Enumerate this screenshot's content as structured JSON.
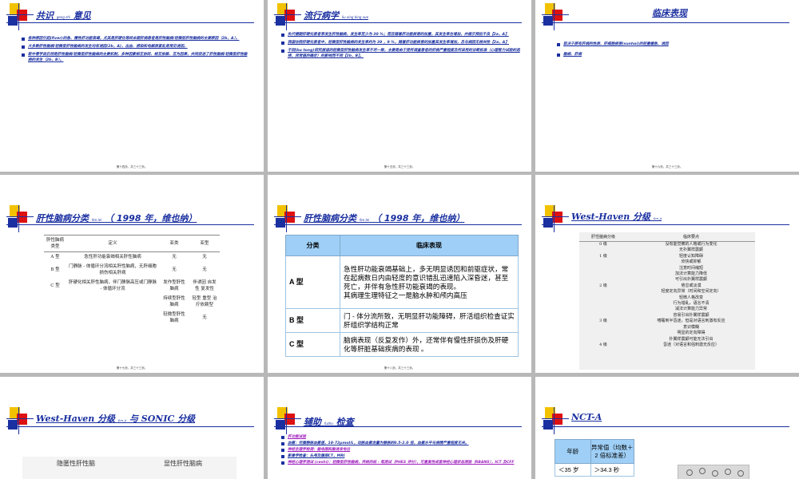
{
  "slides": {
    "s0": {
      "title": "共识",
      "title_small": "gong shi",
      "title_tail": "意见",
      "bullets": [
        "各种原因引起(fiver)的急、慢性肝功能衰竭，尤其是肝硬化等终末期肝病患者是肝性脑病/轻微型肝性脑病的主要原因（2b，A）。",
        "大多数肝性脑病/轻微型肝性脑病的发生均有诱因(2b，A)，出血、感染和电解质紊乱是常见诱因。",
        "新中青学说仍然是肝性脑病/轻微型肝性脑病的主要机制，多种因素相互协同、相互依赖、互为因果，共同促进了肝性脑病/轻微型肝性脑病的发生（2b，B）。"
      ],
      "footer": "第十四页，共三十三页。"
    },
    "s1": {
      "title": "流行病学",
      "title_small": "liu xing bing xue",
      "bullets": [
        "失代偿期肝硬化患者常发生肝性脑病，发生率至少为 30 %；而且随着肝功能损害的加重，其发生率也增加，并提示预后不良【2a，A】",
        "我国住院肝硬化患者中，轻微型肝性脑病的发生率约为 39 ，9 %，随着肝功能损害的加重其发生率增加，且与病因无相关性【2a，A】",
        "不同(bu tong)研究报道的轻微型肝性脑病发生率不尽一致，主要是由于受所调查患者的肝病严重程度及所采用的诊断标准（心理智力试验的选择，异常值的确定）的影响而不同【2b，B】。"
      ],
      "footer": "第十五页，共三十三页。"
    },
    "s2": {
      "title": "临床表现",
      "bullets": [
        "取决于原有肝病的性质、肝细胞损害(sunhai)的轻重缓急、诱因",
        "脑病、肝病"
      ],
      "footer": "第十六页，共三十三页。"
    },
    "s3": {
      "title": "肝性脑病分类",
      "title_small": "fen lei",
      "title_tail": "（ 1998 年，维也纳）",
      "table": {
        "headers": [
          "肝性脑病类型",
          "定义",
          "亚类",
          "亚型"
        ],
        "rows": [
          [
            "A 型",
            "急性肝功能衰竭相关肝性脑病",
            "无",
            "无"
          ],
          [
            "B 型",
            "门静脉 - 体循环分流相关肝性脑病，无肝细胞损伤相关肝病",
            "无",
            "无"
          ],
          [
            "C 型",
            "肝硬化相关肝性脑病，伴门静脉高压或门静脉 - 体循环分流",
            "发作型肝性脑病",
            "伴诱因 自发性 复发性"
          ],
          [
            "",
            "",
            "持续型肝性脑病",
            "轻型 重型 治疗依赖型"
          ],
          [
            "",
            "",
            "轻微型肝性脑病",
            "无"
          ]
        ]
      },
      "footer": "第十七页，共三十三页。"
    },
    "s4": {
      "title": "肝性脑病分类",
      "title_small": "fen lei",
      "title_tail": "（ 1998 年，维也纳）",
      "table": {
        "headers": [
          "分类",
          "临床表现"
        ],
        "rows": [
          [
            "A 型",
            "急性肝功能衰竭基础上，多无明显诱因和前驱症状，常在起病数日内由轻度的意识错乱迅速陷入深昏迷，甚至死亡，并伴有急性肝功能衰竭的表现。\n其病理生理特征之一是脑水肿和颅内高压"
          ],
          [
            "B 型",
            "门 - 体分流所致，无明显肝功能障碍，肝活组织检查证实肝组织学结构正常"
          ],
          [
            "C 型",
            "脑病表现（反复发作）外，还常伴有慢性肝损伤及肝硬化等肝脏基础疾病的表现 。"
          ]
        ]
      },
      "footer": "第十八页，共三十三页。"
    },
    "s5": {
      "title": "West-Haven  分级",
      "title_small": "fen ji",
      "header": [
        "肝性脑病分级",
        "临床要点"
      ],
      "rows": [
        [
          "0 级",
          "没有能觉察的人格或行为变化"
        ],
        [
          "",
          "无扑翼样震颤"
        ],
        [
          "1 级",
          "轻度认知障碍"
        ],
        [
          "",
          "欣快或抑郁"
        ],
        [
          "",
          "注意时间缩短"
        ],
        [
          "",
          "加法计算能力降低"
        ],
        [
          "",
          "可引出扑翼样震颤"
        ],
        [
          "2 级",
          "倦怠或淡漠"
        ],
        [
          "",
          "轻度定向异常（时间和空间定向）"
        ],
        [
          "",
          "轻微人格改变"
        ],
        [
          "",
          "行为错乱，语言不清"
        ],
        [
          "",
          "减法计算能力异常"
        ],
        [
          "",
          "容易引出扑翼样震颤"
        ],
        [
          "3 级",
          "嗜睡到半昏迷，但是对语言刺激有反应"
        ],
        [
          "",
          "意识模糊"
        ],
        [
          "",
          "明显的定向障碍"
        ],
        [
          "",
          "扑翼样震颤可能无法引出"
        ],
        [
          "4 级",
          "昏迷（对语言和强刺激无反应）"
        ]
      ]
    },
    "s6": {
      "title": "West-Haven  分级",
      "title_small": "fen ji",
      "title_tail": " 与 SONIC  分级",
      "left_label": "隐匿性肝性脑",
      "right_label": "显性肝性脑病"
    },
    "s7": {
      "title": "辅助",
      "title_small": "fuzhu",
      "title_tail": " 检查",
      "bullets": [
        "肝功能试验",
        "血氨：空腹静脉血氨值，18-72μmol/L，动脉血氨含量为静脉的0.5-2.0 倍，血氨水平与病情严重程度无关。",
        "神经生理学检测：脑电图和脑诱发电位",
        "影像学检查：头颅及腹部CT，MRI",
        "神经心理学测试 (ceshi)：轻微型肝性脑病，传统的纸 - 笔测试（PHES 评分），可重复性成套神经心理状态测验（RBANS），ICT 及CFF"
      ],
      "magenta_idx": [
        0,
        2,
        4
      ]
    },
    "s8": {
      "title": "NCT-A",
      "table_headers": [
        "年龄",
        "异常值（均数＋2 倍标准差）"
      ],
      "table_rows": [
        [
          "＜35 岁",
          "＞34.3 秒"
        ]
      ]
    }
  }
}
